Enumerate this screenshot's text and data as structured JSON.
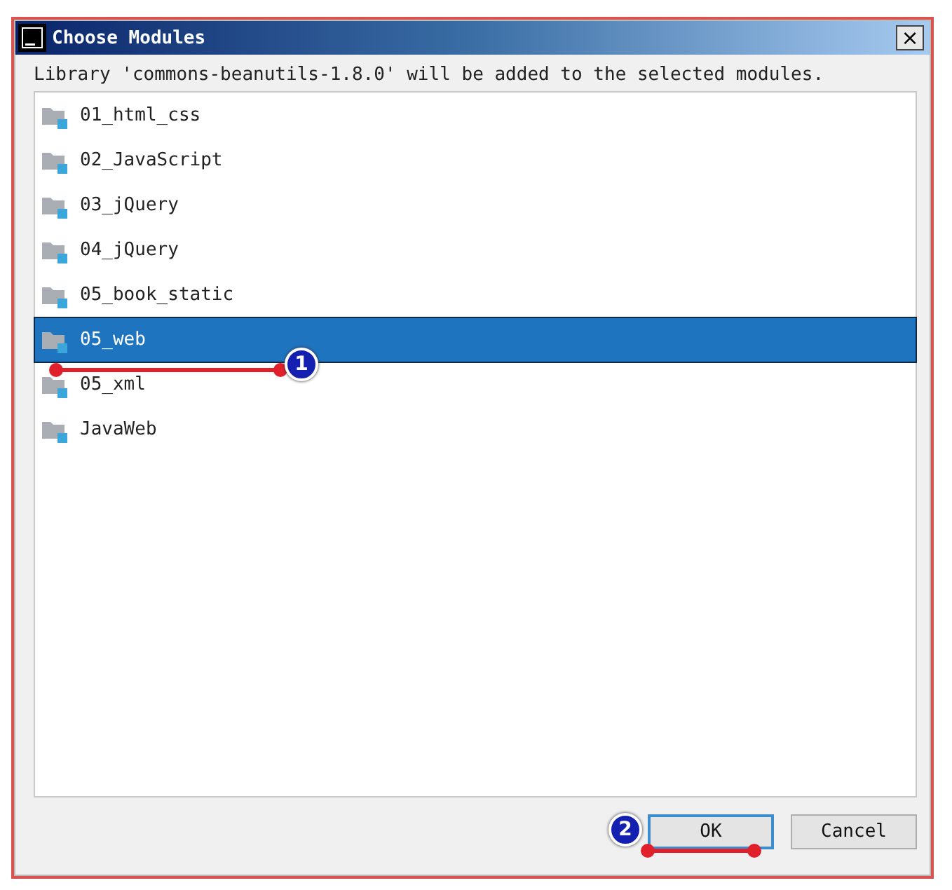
{
  "window": {
    "title": "Choose Modules",
    "close_label": "×"
  },
  "message": "Library 'commons-beanutils-1.8.0' will be added to the selected modules.",
  "modules": [
    {
      "name": "01_html_css",
      "selected": false
    },
    {
      "name": "02_JavaScript",
      "selected": false
    },
    {
      "name": "03_jQuery",
      "selected": false
    },
    {
      "name": "04_jQuery",
      "selected": false
    },
    {
      "name": "05_book_static",
      "selected": false
    },
    {
      "name": "05_web",
      "selected": true
    },
    {
      "name": "05_xml",
      "selected": false
    },
    {
      "name": "JavaWeb",
      "selected": false
    }
  ],
  "buttons": [
    {
      "label": "OK",
      "kind": "default"
    },
    {
      "label": "Cancel",
      "kind": "normal"
    }
  ],
  "annotations": [
    {
      "number": "1",
      "kind": "row"
    },
    {
      "number": "2",
      "kind": "button"
    }
  ]
}
